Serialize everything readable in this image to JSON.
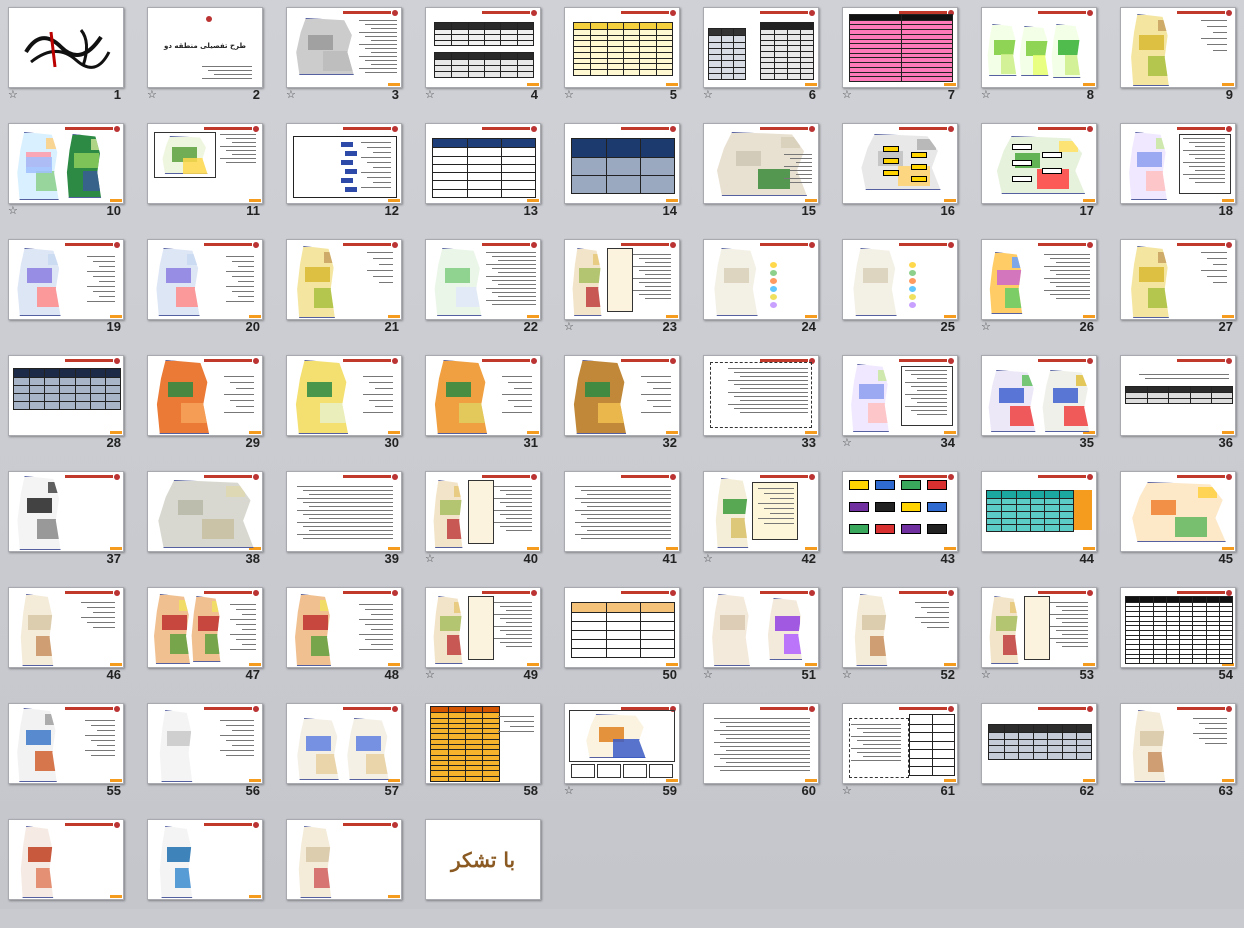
{
  "slides": [
    {
      "n": "1",
      "star": true,
      "kind": "calligraphy"
    },
    {
      "n": "2",
      "star": true,
      "kind": "title"
    },
    {
      "n": "3",
      "star": true,
      "kind": "map-gray"
    },
    {
      "n": "4",
      "star": true,
      "kind": "table-dark"
    },
    {
      "n": "5",
      "star": true,
      "kind": "table-yellow"
    },
    {
      "n": "6",
      "star": true,
      "kind": "table-dark2"
    },
    {
      "n": "7",
      "star": true,
      "kind": "table-pink"
    },
    {
      "n": "8",
      "star": true,
      "kind": "maps-green"
    },
    {
      "n": "9",
      "star": false,
      "kind": "map-yellow"
    },
    {
      "n": "10",
      "star": true,
      "kind": "maps-color"
    },
    {
      "n": "11",
      "star": false,
      "kind": "map-green-box"
    },
    {
      "n": "12",
      "star": false,
      "kind": "chart-blue"
    },
    {
      "n": "13",
      "star": false,
      "kind": "table-lines"
    },
    {
      "n": "14",
      "star": false,
      "kind": "table-bluegray"
    },
    {
      "n": "15",
      "star": false,
      "kind": "map-sat"
    },
    {
      "n": "16",
      "star": false,
      "kind": "map-labels"
    },
    {
      "n": "17",
      "star": false,
      "kind": "map-labels2"
    },
    {
      "n": "18",
      "star": false,
      "kind": "map-text"
    },
    {
      "n": "19",
      "star": false,
      "kind": "map-lines"
    },
    {
      "n": "20",
      "star": false,
      "kind": "map-lines"
    },
    {
      "n": "21",
      "star": false,
      "kind": "map-yellow"
    },
    {
      "n": "22",
      "star": false,
      "kind": "map-green-text"
    },
    {
      "n": "23",
      "star": true,
      "kind": "map-text2"
    },
    {
      "n": "24",
      "star": false,
      "kind": "map-outline"
    },
    {
      "n": "25",
      "star": false,
      "kind": "map-outline"
    },
    {
      "n": "26",
      "star": true,
      "kind": "map-color-text"
    },
    {
      "n": "27",
      "star": false,
      "kind": "map-yellow"
    },
    {
      "n": "28",
      "star": false,
      "kind": "table-bluegray2"
    },
    {
      "n": "29",
      "star": false,
      "kind": "map-orange"
    },
    {
      "n": "30",
      "star": false,
      "kind": "map-green-yellow"
    },
    {
      "n": "31",
      "star": false,
      "kind": "map-orange2"
    },
    {
      "n": "32",
      "star": false,
      "kind": "map-brown"
    },
    {
      "n": "33",
      "star": false,
      "kind": "text-box"
    },
    {
      "n": "34",
      "star": true,
      "kind": "map-text"
    },
    {
      "n": "35",
      "star": false,
      "kind": "maps-two"
    },
    {
      "n": "36",
      "star": false,
      "kind": "table-small"
    },
    {
      "n": "37",
      "star": false,
      "kind": "map-bw"
    },
    {
      "n": "38",
      "star": false,
      "kind": "map-gray2"
    },
    {
      "n": "39",
      "star": false,
      "kind": "text"
    },
    {
      "n": "40",
      "star": true,
      "kind": "map-text2"
    },
    {
      "n": "41",
      "star": false,
      "kind": "text"
    },
    {
      "n": "42",
      "star": true,
      "kind": "map-green-box2"
    },
    {
      "n": "43",
      "star": false,
      "kind": "diagram"
    },
    {
      "n": "44",
      "star": false,
      "kind": "table-teal"
    },
    {
      "n": "45",
      "star": false,
      "kind": "map-region"
    },
    {
      "n": "46",
      "star": false,
      "kind": "map-beige"
    },
    {
      "n": "47",
      "star": false,
      "kind": "maps-lu"
    },
    {
      "n": "48",
      "star": false,
      "kind": "map-lu"
    },
    {
      "n": "49",
      "star": true,
      "kind": "map-text2"
    },
    {
      "n": "50",
      "star": false,
      "kind": "table-tan"
    },
    {
      "n": "51",
      "star": true,
      "kind": "maps-purple"
    },
    {
      "n": "52",
      "star": true,
      "kind": "map-beige"
    },
    {
      "n": "53",
      "star": true,
      "kind": "map-text2"
    },
    {
      "n": "54",
      "star": false,
      "kind": "table-grid"
    },
    {
      "n": "55",
      "star": false,
      "kind": "map-blue"
    },
    {
      "n": "56",
      "star": false,
      "kind": "map-gray-outline"
    },
    {
      "n": "57",
      "star": false,
      "kind": "maps-two-outline"
    },
    {
      "n": "58",
      "star": false,
      "kind": "table-orange"
    },
    {
      "n": "59",
      "star": true,
      "kind": "map-frame"
    },
    {
      "n": "60",
      "star": false,
      "kind": "text"
    },
    {
      "n": "61",
      "star": true,
      "kind": "text-table"
    },
    {
      "n": "62",
      "star": false,
      "kind": "table-dark3"
    },
    {
      "n": "63",
      "star": false,
      "kind": "map-beige"
    },
    {
      "n": "",
      "star": false,
      "kind": "map-red"
    },
    {
      "n": "",
      "star": false,
      "kind": "map-blue2"
    },
    {
      "n": "",
      "star": false,
      "kind": "map-beige2"
    },
    {
      "n": "",
      "star": false,
      "kind": "thanks"
    }
  ],
  "slide2_title": "طرح تفصیلی منطقه دو",
  "thanks_text": "با تشکر",
  "star_glyph": "☆",
  "colors": {
    "accent": "#f59b1e",
    "title_red": "#c0392b"
  }
}
